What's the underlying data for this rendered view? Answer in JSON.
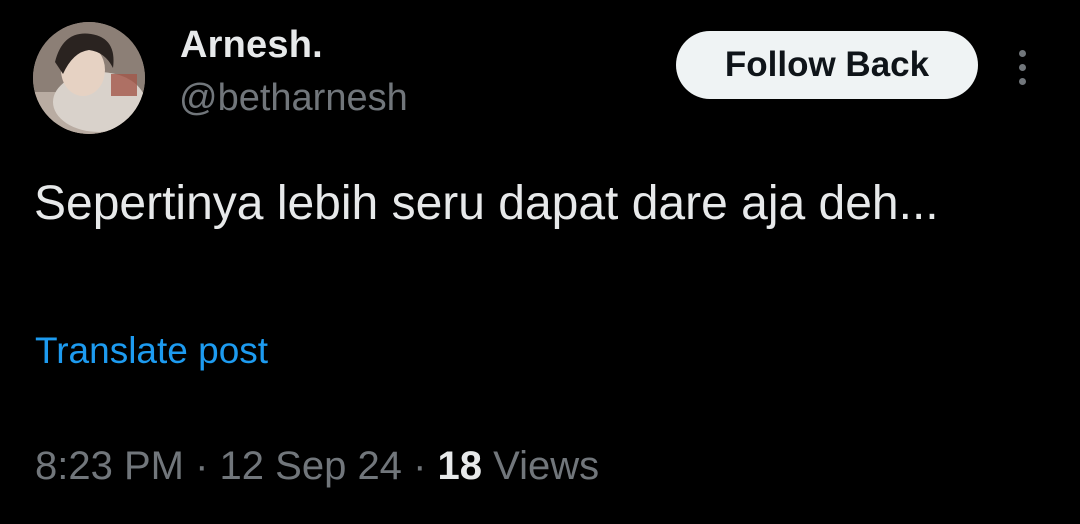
{
  "post": {
    "author": {
      "display_name": "Arnesh.",
      "handle": "@betharnesh",
      "avatar_icon": "profile-photo"
    },
    "follow_button_label": "Follow Back",
    "more_icon": "more-vertical-icon",
    "text": "Sepertinya lebih seru dapat dare aja deh...",
    "translate_label": "Translate post",
    "time": "8:23 PM",
    "date": "12 Sep 24",
    "separator": "·",
    "views_count": "18",
    "views_label": "Views"
  },
  "colors": {
    "background": "#000000",
    "primary_text": "#e7e9ea",
    "secondary_text": "#71767b",
    "link": "#1d9bf0",
    "button_bg": "#eff3f4",
    "button_text": "#0f1419"
  }
}
